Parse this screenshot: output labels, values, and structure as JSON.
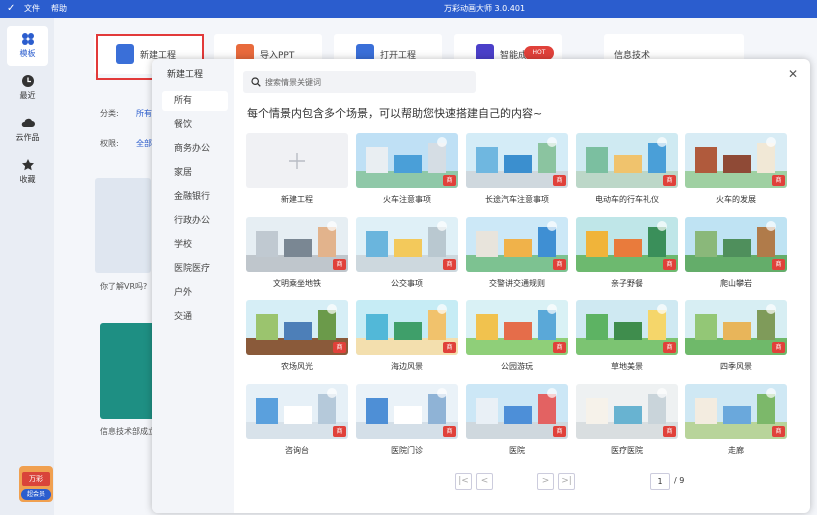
{
  "titlebar": {
    "menu_file": "文件",
    "menu_help": "帮助",
    "app_title": "万彩动画大师 3.0.401"
  },
  "sidebar": {
    "items": [
      {
        "label": "模板",
        "icon": "grid-icon"
      },
      {
        "label": "最近",
        "icon": "clock-icon"
      },
      {
        "label": "云作品",
        "icon": "cloud-icon"
      },
      {
        "label": "收藏",
        "icon": "star-icon"
      }
    ]
  },
  "background": {
    "cards": [
      {
        "label": "新建工程",
        "icon": "new-file-icon"
      },
      {
        "label": "导入PPT",
        "icon": "ppt-icon"
      },
      {
        "label": "打开工程",
        "icon": "folder-icon"
      },
      {
        "label": "智能成片",
        "icon": "ai-icon",
        "badge": "HOT"
      },
      {
        "label": "信息技术"
      }
    ],
    "filter1_label": "分类:",
    "filter1_value": "所有",
    "filter2_label": "权限:",
    "filter2_value": "全部",
    "card1_title": "你了解VR吗?",
    "card2_title": "信息技术部成立",
    "vip_top": "万彩",
    "vip_label": "超会员"
  },
  "modal": {
    "header": "新建工程",
    "search_placeholder": "搜索情景关键词",
    "intro": "每个情景内包含多个场景，可以帮助您快速搭建自己的内容~",
    "categories": [
      "所有",
      "餐饮",
      "商务办公",
      "家居",
      "金融银行",
      "行政办公",
      "学校",
      "医院医疗",
      "户外",
      "交通"
    ],
    "badge": "商",
    "tiles": [
      {
        "label": "新建工程"
      },
      {
        "label": "火车注意事项"
      },
      {
        "label": "长途汽车注意事项"
      },
      {
        "label": "电动车的行车礼仪"
      },
      {
        "label": "火车的发展"
      },
      {
        "label": "文明乘坐地铁"
      },
      {
        "label": "公交事项"
      },
      {
        "label": "交警讲交通规则"
      },
      {
        "label": "亲子野餐"
      },
      {
        "label": "爬山攀岩"
      },
      {
        "label": "农场风光"
      },
      {
        "label": "海边风景"
      },
      {
        "label": "公园游玩"
      },
      {
        "label": "草地美景"
      },
      {
        "label": "四季风景"
      },
      {
        "label": "咨询台"
      },
      {
        "label": "医院门诊"
      },
      {
        "label": "医院"
      },
      {
        "label": "医疗医院"
      },
      {
        "label": "走廊"
      }
    ],
    "pagination": {
      "current": "1",
      "total": "/ 9",
      "first": "|<",
      "prev": "<",
      "next": ">",
      "last": ">|"
    }
  },
  "colors": {
    "accent": "#2b5dce",
    "badge": "#e0413a",
    "highlight_box": "#e23a3a"
  }
}
